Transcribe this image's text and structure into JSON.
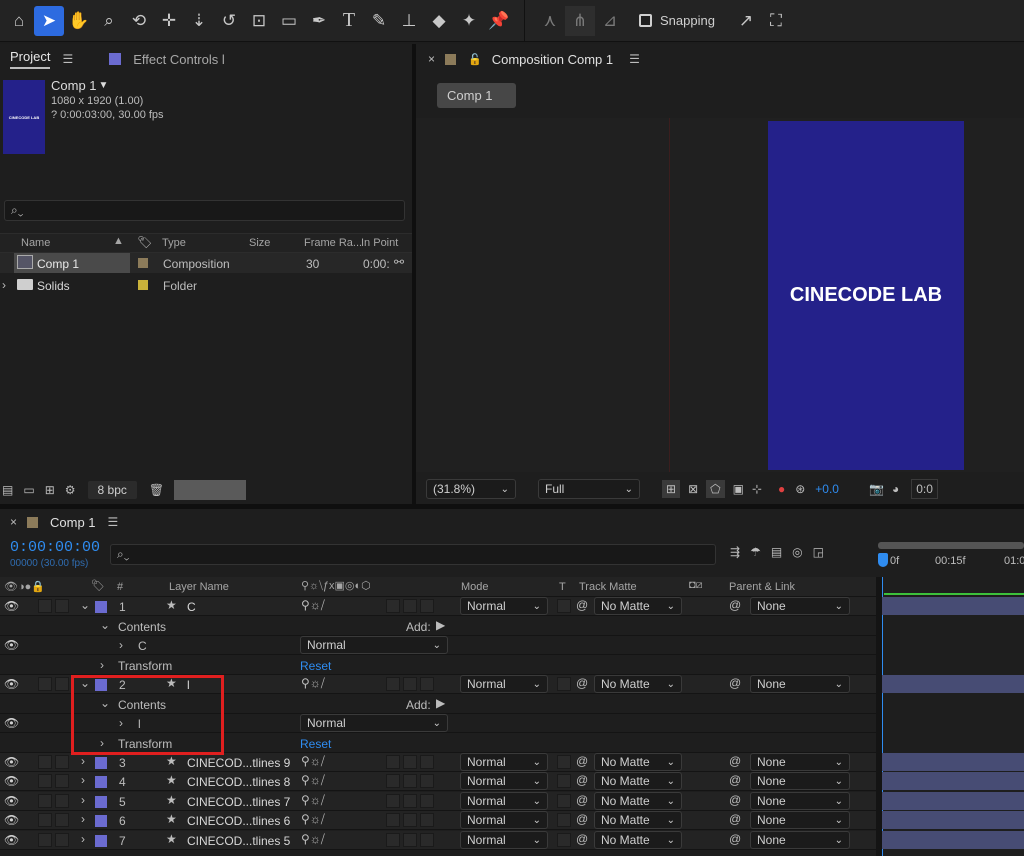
{
  "toolbar": {
    "snapping_label": "Snapping"
  },
  "project_panel": {
    "tab_project": "Project",
    "tab_effect_controls": "Effect Controls l",
    "comp_name": "Comp 1",
    "comp_size": "1080 x 1920 (1.00)",
    "comp_duration": "? 0:00:03:00, 30.00 fps",
    "thumb_text": "CINECODE LAB",
    "search_placeholder": "",
    "columns": [
      "Name",
      "Type",
      "Size",
      "Frame Ra...",
      "In Point"
    ],
    "items": [
      {
        "name": "Comp 1",
        "type": "Composition",
        "frame_rate": "30",
        "in_point": "0:00:",
        "color": "#8c7b5a"
      },
      {
        "name": "Solids",
        "type": "Folder",
        "frame_rate": "",
        "in_point": "",
        "color": "#c9b23a"
      }
    ],
    "bpc": "8 bpc"
  },
  "comp_panel": {
    "title": "Composition Comp 1",
    "crumb": "Comp 1",
    "canvas_text": "CINECODE LAB",
    "canvas_color": "#24218a",
    "zoom": "(31.8%)",
    "resolution": "Full",
    "exposure": "+0.0",
    "time_cut": "0:0"
  },
  "timeline": {
    "tab": "Comp 1",
    "timecode": "0:00:00:00",
    "frames": "00000 (30.00 fps)",
    "search_placeholder": "",
    "headers": {
      "layer_name": "Layer Name",
      "num": "#",
      "mode": "Mode",
      "t": "T",
      "track_matte": "Track Matte",
      "parent": "Parent & Link"
    },
    "ruler": [
      "0f",
      "00:15f",
      "01:0"
    ],
    "add_label": "Add:",
    "contents_label": "Contents",
    "transform_label": "Transform",
    "reset_label": "Reset",
    "layers": [
      {
        "num": "1",
        "name": "C",
        "mode": "Normal",
        "matte": "No Matte",
        "parent": "None"
      },
      {
        "sub_name": "C",
        "sub_mode": "Normal"
      },
      {
        "num": "2",
        "name": "l",
        "mode": "Normal",
        "matte": "No Matte",
        "parent": "None"
      },
      {
        "sub_name": "l",
        "sub_mode": "Normal"
      },
      {
        "num": "3",
        "name": "CINECOD...tlines 9",
        "mode": "Normal",
        "matte": "No Matte",
        "parent": "None"
      },
      {
        "num": "4",
        "name": "CINECOD...tlines 8",
        "mode": "Normal",
        "matte": "No Matte",
        "parent": "None"
      },
      {
        "num": "5",
        "name": "CINECOD...tlines 7",
        "mode": "Normal",
        "matte": "No Matte",
        "parent": "None"
      },
      {
        "num": "6",
        "name": "CINECOD...tlines 6",
        "mode": "Normal",
        "matte": "No Matte",
        "parent": "None"
      },
      {
        "num": "7",
        "name": "CINECOD...tlines 5",
        "mode": "Normal",
        "matte": "No Matte",
        "parent": "None"
      }
    ]
  }
}
